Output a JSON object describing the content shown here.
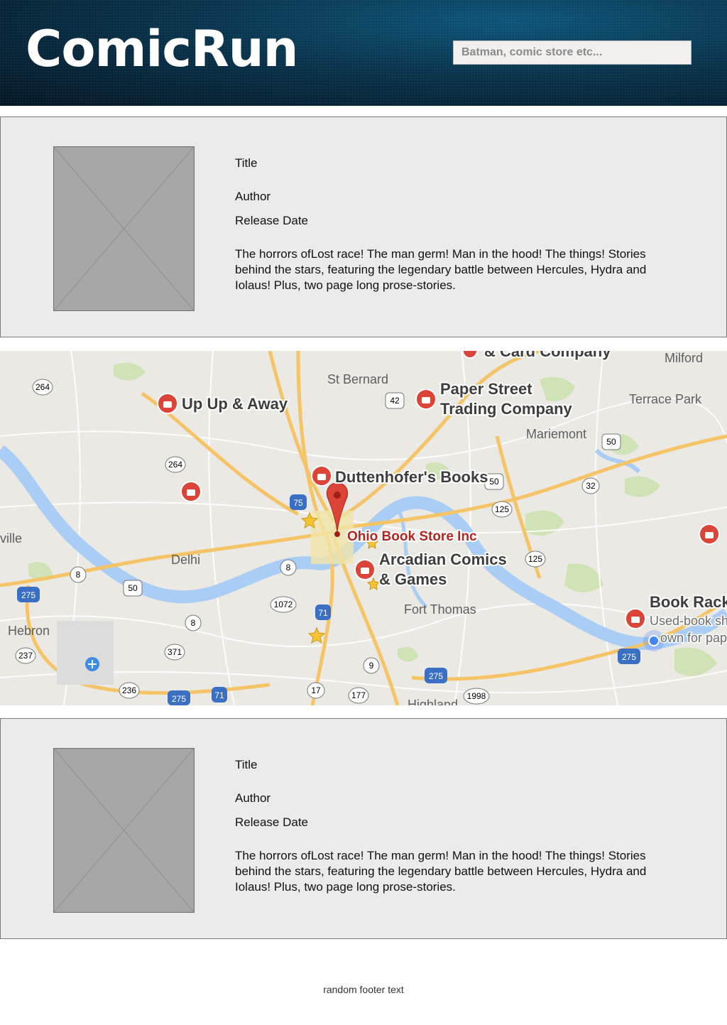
{
  "header": {
    "logo": "ComicRun",
    "search_placeholder": "Batman, comic store etc..."
  },
  "cards": [
    {
      "title": "Title",
      "author": "Author",
      "release_date": "Release Date",
      "description": "The horrors ofLost race! The man germ! Man in the hood! The things! Stories behind the stars, featuring the legendary battle between Hercules, Hydra and Iolaus! Plus, two page long prose-stories."
    },
    {
      "title": "Title",
      "author": "Author",
      "release_date": "Release Date",
      "description": "The horrors ofLost race! The man germ! Man in the hood! The things! Stories behind the stars, featuring the legendary battle between Hercules, Hydra and Iolaus! Plus, two page long prose-stories."
    }
  ],
  "map": {
    "stores": {
      "up_up_away": "Up Up & Away",
      "paper_street_1": "Paper Street",
      "paper_street_2": "Trading Company",
      "duttenhofers": "Duttenhofer's Books",
      "ohio_book": "Ohio Book Store Inc",
      "arcadian_1": "Arcadian Comics",
      "arcadian_2": "& Games",
      "book_rack": "Book Rack",
      "book_rack_sub_1": "Used-book sho",
      "book_rack_sub_2": "own for pap",
      "card_company": "& Card Company"
    },
    "places": {
      "st_bernard": "St Bernard",
      "milford": "Milford",
      "terrace_park": "Terrace Park",
      "mariemont": "Mariemont",
      "ville": "ville",
      "delhi": "Delhi",
      "hebron": "Hebron",
      "fort_thomas": "Fort Thomas",
      "highland": "Highland"
    },
    "routes": {
      "r264a": "264",
      "r264b": "264",
      "r42": "42",
      "r50a": "50",
      "r50b": "50",
      "r50c": "50",
      "r32": "32",
      "r125a": "125",
      "r125b": "125",
      "r75": "75",
      "r8a": "8",
      "r8b": "8",
      "r8c": "8",
      "r275a": "275",
      "r275b": "275",
      "r275c": "275",
      "r275d": "275",
      "r71a": "71",
      "r71b": "71",
      "r1072": "1072",
      "r237": "237",
      "r371": "371",
      "r236": "236",
      "r9": "9",
      "r17": "17",
      "r177": "177",
      "r1998": "1998"
    },
    "colors": {
      "land": "#ebe9e4",
      "water": "#a9cdf4",
      "highway": "#f5c466",
      "road": "#ffffff",
      "park": "#cfe3b6",
      "pin": "#db4437"
    }
  },
  "footer": {
    "text": "random footer text"
  }
}
